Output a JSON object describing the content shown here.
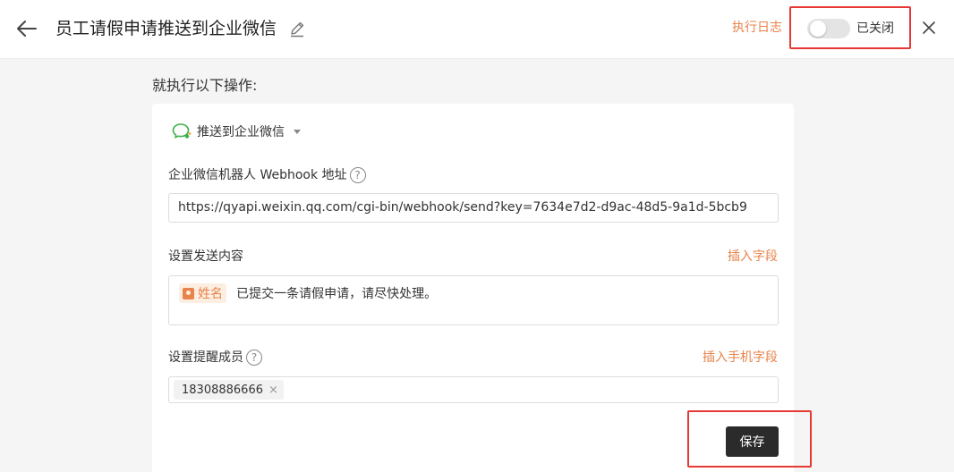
{
  "header": {
    "title": "员工请假申请推送到企业微信",
    "log_link": "执行日志",
    "toggle_label": "已关闭",
    "toggle_on": false
  },
  "main": {
    "section_heading": "就执行以下操作:",
    "action": {
      "label": "推送到企业微信"
    },
    "webhook": {
      "label": "企业微信机器人 Webhook 地址",
      "help": "?",
      "value": "https://qyapi.weixin.qq.com/cgi-bin/webhook/send?key=7634e7d2-d9ac-48d5-9a1d-5bcb9"
    },
    "content": {
      "label": "设置发送内容",
      "insert_link": "插入字段",
      "field_tag": "姓名",
      "text": "已提交一条请假申请，请尽快处理。"
    },
    "members": {
      "label": "设置提醒成员",
      "help": "?",
      "insert_link": "插入手机字段",
      "chips": [
        "18308886666"
      ],
      "chip_remove": "×"
    },
    "save_label": "保存"
  },
  "colors": {
    "accent": "#e8834a",
    "highlight_box": "#e53935",
    "save_bg": "#2b2b2b",
    "wechat_green": "#3bb14a"
  }
}
